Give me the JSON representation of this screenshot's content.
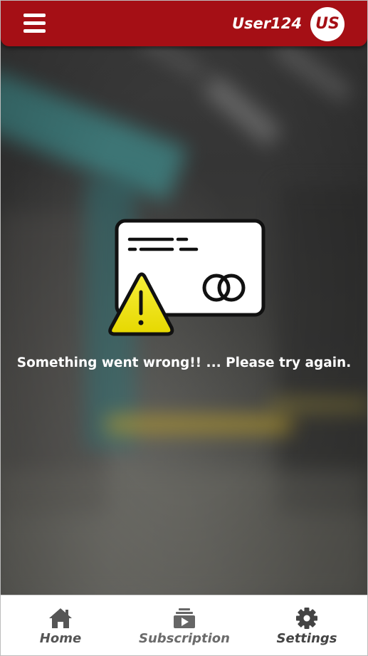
{
  "header": {
    "username": "User124",
    "avatar_initials": "US",
    "accent_color": "#a50f15",
    "menu_icon": "hamburger-menu-icon"
  },
  "main": {
    "error_message": "Something went wrong!! ... Please try again.",
    "illustration_icon": "payment-card-warning-icon"
  },
  "bottom_nav": {
    "items": [
      {
        "label": "Home",
        "icon": "home-icon"
      },
      {
        "label": "Subscription",
        "icon": "subscription-icon"
      },
      {
        "label": "Settings",
        "icon": "gear-icon"
      }
    ]
  }
}
